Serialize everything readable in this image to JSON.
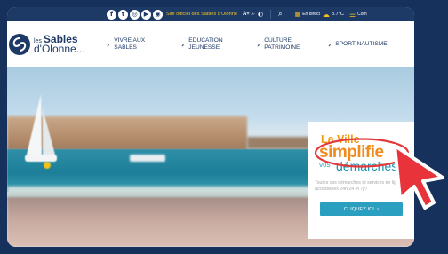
{
  "topbar": {
    "social_icons": [
      "facebook-icon",
      "twitter-icon",
      "instagram-icon",
      "youtube-icon",
      "rss-icon"
    ],
    "social_glyphs": [
      "f",
      "t",
      "◎",
      "▶",
      "◉"
    ],
    "official_site_text": "Site officiel des Sables d'Olonne",
    "font_size_label": "A+",
    "font_size_small_label": "A-",
    "en_direct_label": "En direct",
    "temperature": "8.7°C",
    "menu_label": "Com",
    "colors": {
      "bar_bg": "#1d3966",
      "accent": "#f3c21a"
    }
  },
  "logo": {
    "line1_small": "les",
    "line1_big": "Sables",
    "line2": "d'Olonne..."
  },
  "nav": {
    "items": [
      {
        "label": "VIVRE AUX\nSABLES"
      },
      {
        "label": "EDUCATION\nJEUNESSE"
      },
      {
        "label": "CULTURE\nPATRIMOINE"
      },
      {
        "label": "SPORT NAUTISME"
      }
    ],
    "chevron": "›"
  },
  "promo": {
    "title_line1": "La Ville",
    "title_line2": "simplifie",
    "title_line3a": "vos",
    "title_line3b": "démarches",
    "description": "Toutes vos démarches et services en ligne, accessibles 24h/24 et 7j/7",
    "cta_label": "CLIQUEZ ICI",
    "cta_arrow": "›",
    "colors": {
      "orange": "#f08b1c",
      "blue": "#1b90b3",
      "button": "#2b9fc0"
    }
  },
  "annotation": {
    "ring_color": "#e23a3a",
    "cursor_color": "#e8333a"
  }
}
